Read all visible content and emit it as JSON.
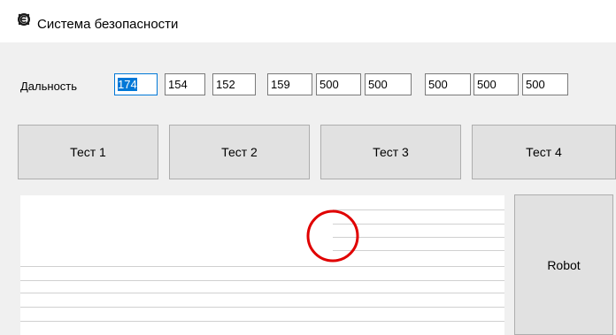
{
  "window": {
    "icon": "app-emblem-icon",
    "title": "Система безопасности"
  },
  "range_label": "Дальность",
  "range_fields": [
    "174",
    "154",
    "152",
    "159",
    "500",
    "500",
    "500",
    "500",
    "500"
  ],
  "focused_field_index": 0,
  "test_buttons": [
    "Тест 1",
    "Тест 2",
    "Тест 3",
    "Тест 4"
  ],
  "robot_button": "Robot",
  "colors": {
    "selection": "#0078d7",
    "indicator_ring": "#e00000",
    "grid_line": "#d0d0d0",
    "client_background": "#f0f0f0"
  }
}
